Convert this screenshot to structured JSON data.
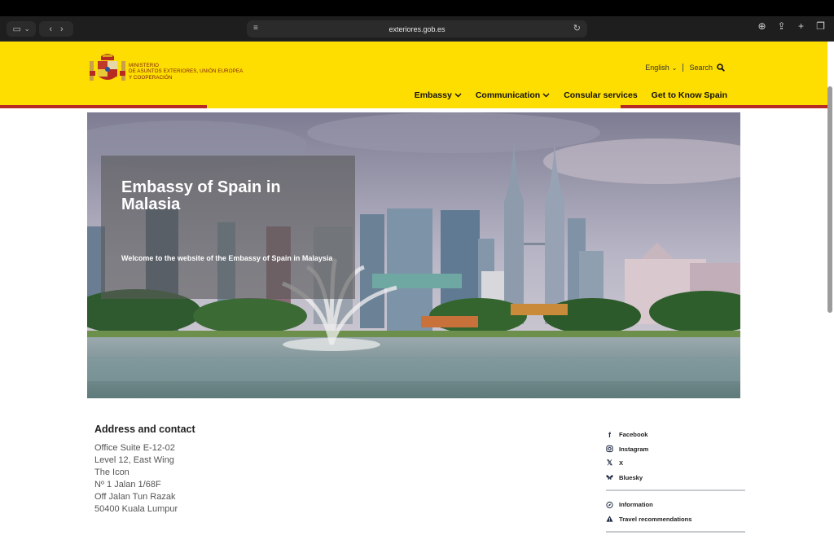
{
  "browser": {
    "url": "exteriores.gob.es"
  },
  "header": {
    "ministry_line1": "MINISTERIO",
    "ministry_line2": "DE ASUNTOS EXTERIORES, UNIÓN EUROPEA",
    "ministry_line3": "Y COOPERACIÓN",
    "language": "English",
    "search_label": "Search",
    "nav": [
      {
        "label": "Embassy",
        "dropdown": true
      },
      {
        "label": "Communication",
        "dropdown": true
      },
      {
        "label": "Consular services",
        "dropdown": false
      },
      {
        "label": "Get to Know Spain",
        "dropdown": false
      }
    ],
    "colors": {
      "brand_yellow": "#fedd00",
      "brand_red": "#b72a21"
    }
  },
  "hero": {
    "title": "Embassy of Spain in Malasia",
    "subtitle": "Welcome to the website of the Embassy of Spain in Malaysia"
  },
  "contact": {
    "title": "Address and contact",
    "lines": [
      "Office Suite E-12-02",
      "Level 12, East Wing",
      "The Icon",
      "Nº 1 Jalan 1/68F",
      "Off Jalan Tun Razak",
      "50400 Kuala Lumpur"
    ]
  },
  "social": [
    {
      "label": "Facebook",
      "icon": "facebook-icon"
    },
    {
      "label": "Instagram",
      "icon": "instagram-icon"
    },
    {
      "label": "X",
      "icon": "x-icon"
    },
    {
      "label": "Bluesky",
      "icon": "bluesky-icon"
    }
  ],
  "links": [
    {
      "label": "Information",
      "icon": "compass-icon"
    },
    {
      "label": "Travel recommendations",
      "icon": "warning-icon"
    }
  ]
}
